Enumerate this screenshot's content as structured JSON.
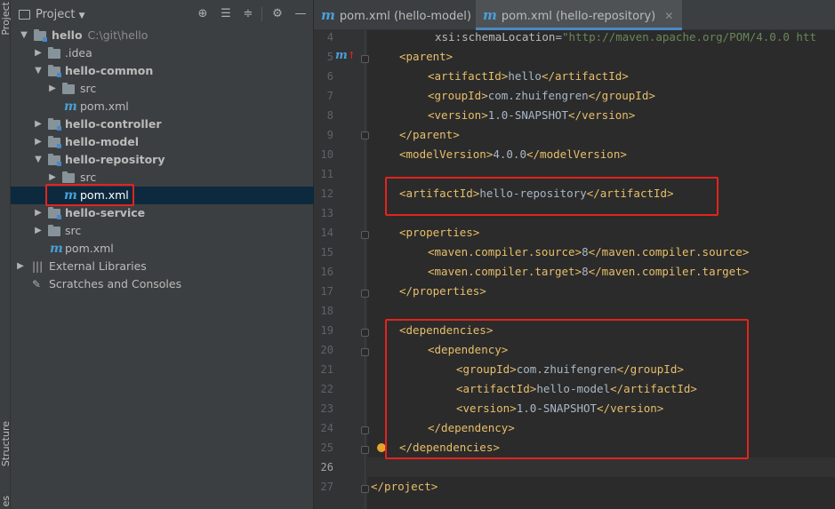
{
  "tool_strip": {
    "project_label": "Project",
    "structure_label": "Structure",
    "bottom_label": "es"
  },
  "project_panel": {
    "title": "Project",
    "icons": [
      "target-icon",
      "expand-all-icon",
      "collapse-all-icon",
      "gear-icon",
      "hide-icon"
    ],
    "tree": [
      {
        "label": "hello",
        "path": "C:\\git\\hello"
      },
      {
        "label": ".idea"
      },
      {
        "label": "hello-common"
      },
      {
        "label": "src"
      },
      {
        "label": "pom.xml"
      },
      {
        "label": "hello-controller"
      },
      {
        "label": "hello-model"
      },
      {
        "label": "hello-repository"
      },
      {
        "label": "src"
      },
      {
        "label": "pom.xml"
      },
      {
        "label": "hello-service"
      },
      {
        "label": "src"
      },
      {
        "label": "pom.xml"
      },
      {
        "label": "External Libraries"
      },
      {
        "label": "Scratches and Consoles"
      }
    ]
  },
  "tabs": [
    {
      "label": "pom.xml (hello-model)",
      "active": false
    },
    {
      "label": "pom.xml (hello-repository)",
      "active": true
    }
  ],
  "editor": {
    "line_numbers": [
      "4",
      "5",
      "6",
      "7",
      "8",
      "9",
      "10",
      "11",
      "12",
      "13",
      "14",
      "15",
      "16",
      "17",
      "18",
      "19",
      "20",
      "21",
      "22",
      "23",
      "24",
      "25",
      "26",
      "27"
    ],
    "lines": [
      {
        "attr": "xsi:schemaLocation",
        "eq": "=",
        "val": "\"http://maven.apache.org/POM/4.0.0 htt"
      },
      {
        "open": "<parent>"
      },
      {
        "open": "<artifactId>",
        "text": "hello",
        "close": "</artifactId>"
      },
      {
        "open": "<groupId>",
        "text": "com.zhuifengren",
        "close": "</groupId>"
      },
      {
        "open": "<version>",
        "text": "1.0-SNAPSHOT",
        "close": "</version>"
      },
      {
        "open": "</parent>"
      },
      {
        "open": "<modelVersion>",
        "text": "4.0.0",
        "close": "</modelVersion>"
      },
      {
        "open": ""
      },
      {
        "open": "<artifactId>",
        "text": "hello-repository",
        "close": "</artifactId>"
      },
      {
        "open": ""
      },
      {
        "open": "<properties>"
      },
      {
        "open": "<maven.compiler.source>",
        "text": "8",
        "close": "</maven.compiler.source>"
      },
      {
        "open": "<maven.compiler.target>",
        "text": "8",
        "close": "</maven.compiler.target>"
      },
      {
        "open": "</properties>"
      },
      {
        "open": ""
      },
      {
        "open": "<dependencies>"
      },
      {
        "open": "<dependency>"
      },
      {
        "open": "<groupId>",
        "text": "com.zhuifengren",
        "close": "</groupId>"
      },
      {
        "open": "<artifactId>",
        "text": "hello-model",
        "close": "</artifactId>"
      },
      {
        "open": "<version>",
        "text": "1.0-SNAPSHOT",
        "close": "</version>"
      },
      {
        "open": "</dependency>"
      },
      {
        "open": "</dependencies>"
      },
      {
        "open": ""
      },
      {
        "open": "</project>"
      }
    ],
    "current_line": "26"
  },
  "colors": {
    "highlight_box": "#e5231c",
    "tag": "#e8bf6a",
    "text": "#a9b7c6",
    "accent": "#4a88c7"
  }
}
